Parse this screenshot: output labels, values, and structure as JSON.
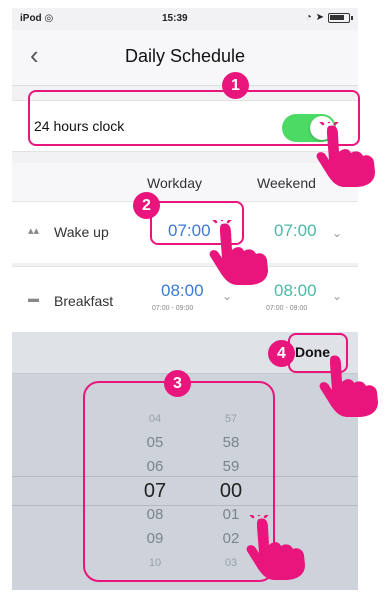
{
  "status_bar": {
    "carrier": "iPod",
    "time": "15:39"
  },
  "nav": {
    "title": "Daily Schedule"
  },
  "clock_setting": {
    "label": "24 hours clock",
    "enabled": true
  },
  "columns": {
    "workday": "Workday",
    "weekend": "Weekend"
  },
  "rows": [
    {
      "icon": "bed-icon",
      "label": "Wake up",
      "workday": "07:00",
      "weekend": "07:00"
    },
    {
      "icon": "plate-icon",
      "label": "Breakfast",
      "workday": "08:00",
      "workday_range": "07:00 - 09:00",
      "weekend": "08:00",
      "weekend_range": "07:00 - 09:00"
    }
  ],
  "picker": {
    "done_label": "Done",
    "hours": [
      "04",
      "05",
      "06",
      "07",
      "08",
      "09",
      "10"
    ],
    "minutes": [
      "57",
      "58",
      "59",
      "00",
      "01",
      "02",
      "03"
    ]
  },
  "callouts": [
    "1",
    "2",
    "3",
    "4"
  ],
  "colors": {
    "accent": "#e8157d",
    "toggle_on": "#4cd964",
    "time_blue": "#3a7bd5",
    "time_teal": "#4db8a8"
  }
}
